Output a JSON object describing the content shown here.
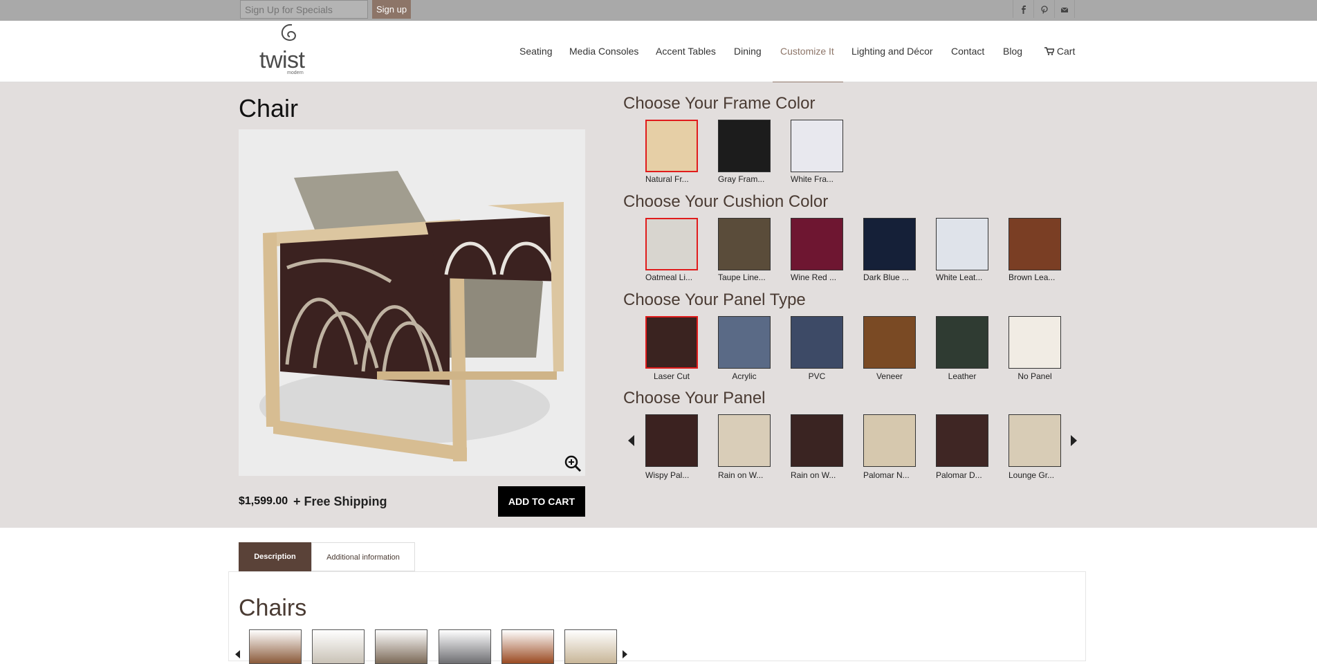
{
  "topbar": {
    "signup_placeholder": "Sign Up for Specials",
    "signup_button": "Sign up",
    "social": [
      "facebook-icon",
      "pinterest-icon",
      "mail-icon"
    ]
  },
  "brand": {
    "name": "twist",
    "tagline": "modern"
  },
  "nav": {
    "items": [
      "Seating",
      "Media Consoles",
      "Accent Tables",
      "Dining",
      "Customize It",
      "Lighting and Décor",
      "Contact",
      "Blog"
    ],
    "active": "Customize It",
    "cart_label": "Cart"
  },
  "product": {
    "title": "Chair",
    "price": "$1,599.00",
    "plus": "+",
    "shipping": "Free Shipping",
    "add_to_cart": "ADD TO CART"
  },
  "frame_color": {
    "title": "Choose Your Frame Color",
    "options": [
      {
        "label": "Natural Fr...",
        "color": "#e6cfa6",
        "selected": true
      },
      {
        "label": "Gray Fram...",
        "color": "#1c1c1c",
        "selected": false
      },
      {
        "label": "White Fra...",
        "color": "#e8e8ee",
        "selected": false
      }
    ]
  },
  "cushion_color": {
    "title": "Choose Your Cushion Color",
    "options": [
      {
        "label": "Oatmeal Li...",
        "color": "#d8d5cf",
        "selected": true
      },
      {
        "label": "Taupe Line...",
        "color": "#5a4c3a",
        "selected": false
      },
      {
        "label": "Wine Red ...",
        "color": "#6e1631",
        "selected": false
      },
      {
        "label": "Dark Blue ...",
        "color": "#152038",
        "selected": false
      },
      {
        "label": "White Leat...",
        "color": "#dfe3ea",
        "selected": false
      },
      {
        "label": "Brown Lea...",
        "color": "#7a3e24",
        "selected": false
      }
    ]
  },
  "panel_type": {
    "title": "Choose Your Panel Type",
    "options": [
      {
        "label": "Laser Cut",
        "color": "#3a2320",
        "selected": true
      },
      {
        "label": "Acrylic",
        "color": "#5a6a86",
        "selected": false
      },
      {
        "label": "PVC",
        "color": "#3d4a66",
        "selected": false
      },
      {
        "label": "Veneer",
        "color": "#7a4a24",
        "selected": false
      },
      {
        "label": "Leather",
        "color": "#2f3b32",
        "selected": false
      },
      {
        "label": "No Panel",
        "color": "#f1ece4",
        "selected": false
      }
    ]
  },
  "panel": {
    "title": "Choose Your Panel",
    "options": [
      {
        "label": "Wispy Pal...",
        "color": "#3b2220"
      },
      {
        "label": "Rain on W...",
        "color": "#d9cdb8"
      },
      {
        "label": "Rain on W...",
        "color": "#3a2422"
      },
      {
        "label": "Palomar N...",
        "color": "#d6c8ae"
      },
      {
        "label": "Palomar D...",
        "color": "#3f2624"
      },
      {
        "label": "Lounge Gr...",
        "color": "#d8ccb6"
      }
    ]
  },
  "tabs": {
    "description": "Description",
    "additional": "Additional information"
  },
  "related": {
    "title": "Chairs",
    "thumbs": [
      "#8a5a3a",
      "#c9c2b6",
      "#7c6a58",
      "#6e6e72",
      "#9a4a22",
      "#c8b698"
    ]
  }
}
